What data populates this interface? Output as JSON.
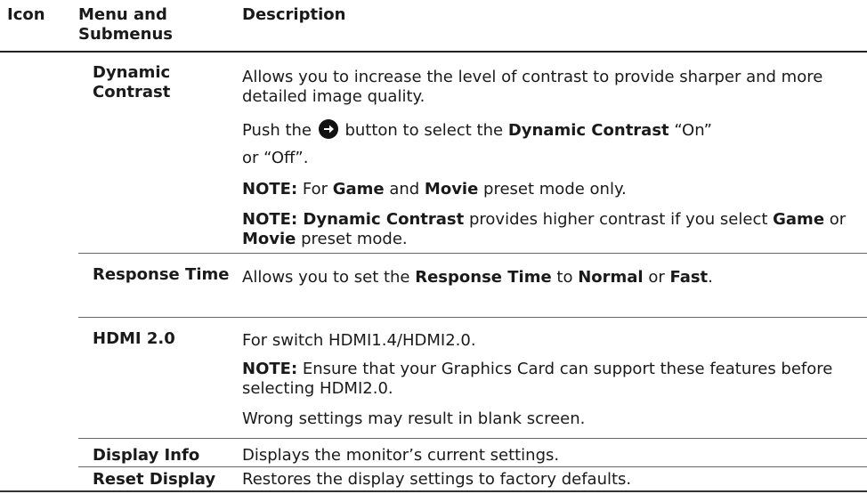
{
  "header": {
    "icon": "Icon",
    "menu": "Menu and Submenus",
    "description": "Description"
  },
  "rows": {
    "dynamic_contrast": {
      "name": "Dynamic Contrast",
      "line1": "Allows you to increase the level of contrast to provide sharper and more detailed image quality.",
      "push_pre": "Push the",
      "push_mid": " button to select the ",
      "push_bold": "Dynamic Contrast",
      "push_post": " “On”",
      "or_off": "or “Off”.",
      "note1_label": "NOTE:",
      "note1_pre": " For ",
      "note1_game": "Game",
      "note1_and": " and ",
      "note1_movie": "Movie",
      "note1_post": " preset mode only.",
      "note2_label": "NOTE: Dynamic Contrast",
      "note2_text": " provides higher contrast if you select ",
      "note2_game": "Game",
      "note2_or": " or ",
      "note2_movie": "Movie",
      "note2_post": " preset mode."
    },
    "response_time": {
      "name": "Response Time",
      "pre": "Allows you to set the ",
      "bold1": "Response Time",
      "to": " to ",
      "bold2": "Normal",
      "or": " or ",
      "bold3": "Fast",
      "end": "."
    },
    "hdmi": {
      "name": "HDMI 2.0",
      "line1": "For switch HDMI1.4/HDMI2.0.",
      "note_label": "NOTE:",
      "note_text": " Ensure that your Graphics Card can support these features before selecting HDMI2.0.",
      "line3": "Wrong settings may result in blank screen."
    },
    "display_info": {
      "name": "Display Info",
      "text": "Displays the monitor’s current settings."
    },
    "reset_display": {
      "name": "Reset Display",
      "text": "Restores the display settings to factory defaults."
    }
  },
  "icons": {
    "arrow_button": "arrow-right-circle-icon"
  }
}
